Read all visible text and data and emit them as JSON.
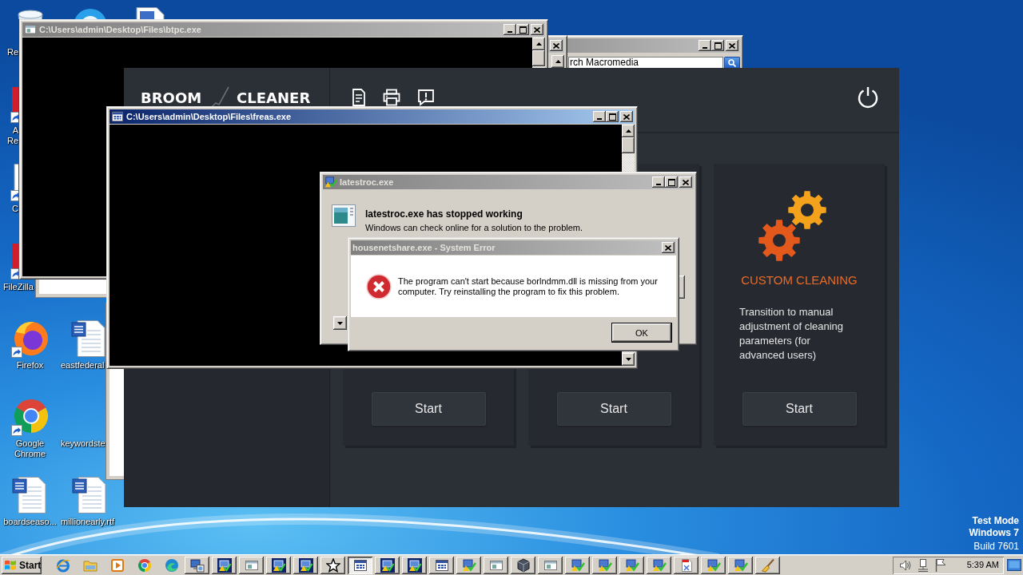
{
  "desktop": {
    "icons": [
      {
        "kind": "recycle-bin",
        "lines": [
          "Re"
        ]
      },
      {
        "kind": "app"
      },
      {
        "kind": "document"
      },
      {
        "kind": "red-app",
        "lines": [
          "A",
          "Re"
        ]
      },
      {
        "kind": "shortcut",
        "lines": [
          "C"
        ]
      },
      {
        "kind": "red-app",
        "lines": [
          "FileZilla"
        ]
      },
      {
        "kind": "firefox",
        "lines": [
          "Firefox"
        ]
      },
      {
        "kind": "word",
        "lines": [
          "eastfederal"
        ]
      },
      {
        "kind": "chrome",
        "lines": [
          "Google",
          "Chrome"
        ]
      },
      {
        "kind": "blank",
        "lines": [
          "keywordste"
        ]
      },
      {
        "kind": "word",
        "lines": [
          "boardseaso..."
        ]
      },
      {
        "kind": "word",
        "lines": [
          "millionearly.rtf"
        ]
      }
    ],
    "test_mode": [
      "Test Mode",
      "Windows 7",
      "Build 7601"
    ]
  },
  "search_window": {
    "active": false,
    "search_value": "rch Macromedia"
  },
  "console_windows": [
    {
      "title": "C:\\Users\\admin\\Desktop\\Files\\btpc.exe",
      "active": false
    },
    {
      "title": "C:\\Users\\admin\\Desktop\\Files\\freas.exe",
      "active": true
    }
  ],
  "broom_cleaner": {
    "logo_words": [
      "BROOM",
      "CLEANER"
    ],
    "cards": [
      {
        "button": "Start"
      },
      {
        "button": "Start"
      },
      {
        "title": "CUSTOM CLEANING",
        "description": "Transition to manual adjustment of cleaning parameters (for advanced users)",
        "button": "Start"
      }
    ]
  },
  "crash_dialog": {
    "title": "latestroc.exe",
    "active": false,
    "heading": "latestroc.exe has stopped working",
    "text": "Windows can check online for a solution to the problem."
  },
  "error_dialog": {
    "title": "housenetshare.exe - System Error",
    "active": false,
    "message": "The program can't start because borlndmm.dll is missing from your computer. Try reinstalling the program to fix this problem.",
    "button": "OK"
  },
  "taskbar": {
    "start": "Start",
    "quick_launch": [
      {
        "kind": "ie"
      },
      {
        "kind": "explorer"
      },
      {
        "kind": "media"
      },
      {
        "kind": "chrome"
      },
      {
        "kind": "edge"
      }
    ],
    "tasks": [
      {
        "kind": "setup",
        "selected": false
      },
      {
        "kind": "wer",
        "selected": false
      },
      {
        "kind": "window",
        "selected": false
      },
      {
        "kind": "wer",
        "selected": false
      },
      {
        "kind": "wer",
        "selected": false
      },
      {
        "kind": "star",
        "selected": false
      },
      {
        "kind": "console",
        "selected": true
      },
      {
        "kind": "wer",
        "selected": false
      },
      {
        "kind": "wer",
        "selected": false
      },
      {
        "kind": "console",
        "selected": false
      },
      {
        "kind": "check",
        "selected": false
      },
      {
        "kind": "window",
        "selected": false
      },
      {
        "kind": "package",
        "selected": false
      },
      {
        "kind": "window",
        "selected": false
      },
      {
        "kind": "check",
        "selected": false
      },
      {
        "kind": "check",
        "selected": false
      },
      {
        "kind": "check",
        "selected": false
      },
      {
        "kind": "check",
        "selected": false
      },
      {
        "kind": "document",
        "selected": false
      },
      {
        "kind": "check",
        "selected": false
      },
      {
        "kind": "check",
        "selected": false
      },
      {
        "kind": "broom",
        "selected": false
      }
    ],
    "clock": "5:39 AM"
  }
}
